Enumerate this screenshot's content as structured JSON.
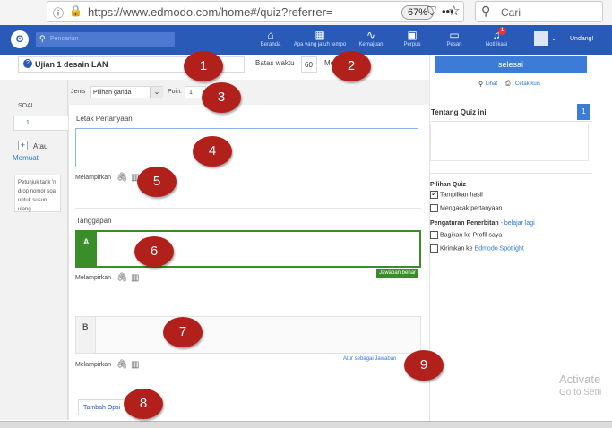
{
  "browser": {
    "url": "https://www.edmodo.com/home#/quiz?referrer=",
    "zoom": "67%",
    "search_placeholder": "Cari"
  },
  "nav": {
    "search_placeholder": "Pencarian",
    "items": [
      {
        "label": "Beranda",
        "icon": "home-icon"
      },
      {
        "label": "Apa yang jatuh tempo",
        "icon": "calendar-icon"
      },
      {
        "label": "Kemajuan",
        "icon": "progress-icon"
      },
      {
        "label": "Perpus",
        "icon": "library-icon"
      },
      {
        "label": "Pesan",
        "icon": "message-icon"
      },
      {
        "label": "Notifikasi",
        "icon": "bell-icon"
      }
    ],
    "notification_count": "1",
    "user_label": "Undang!"
  },
  "quiz": {
    "title": "Ujian 1 desain LAN",
    "time_limit_label": "Batas waktu",
    "time_limit_value": "60",
    "time_unit": "Me"
  },
  "sidebar": {
    "soal_label": "SOAL",
    "question_number": "1",
    "add_label": "Atau",
    "add_sub": "Memuat",
    "hint": "Petunjuk tarik 'n drop nomor soal untuk susun ulang"
  },
  "question": {
    "type_label": "Jenis",
    "type_value": "Pilihan ganda",
    "points_label": "Poin:",
    "points_value": "1",
    "section_title": "Letak Pertanyaan",
    "attach_label": "Melampirkan"
  },
  "responses": {
    "title": "Tanggapan",
    "option_a": "A",
    "option_b": "B",
    "correct_badge": "Jawaban benar",
    "set_correct": "Atur sebagai Jawaban",
    "attach_label": "Melampirkan",
    "add_option": "Tambah Opsi"
  },
  "right": {
    "done_button": "selesai",
    "preview": "Lihat",
    "print": "Cetak kuis",
    "about_title": "Tentang Quiz ini",
    "about_badge": "1",
    "options_title": "Pilihan Quiz",
    "opt_show_results": "Tampilkan hasil",
    "opt_shuffle": "Mengacak pertanyaan",
    "publish_title": "Pengaturan Penerbitan",
    "publish_link": "belajar lagi",
    "opt_share_profile": "Bagikan ke Profil saya",
    "opt_send_prefix": "Kirimkan ke",
    "opt_send_link": "Edmodo Spotlight"
  },
  "markers": [
    "1",
    "2",
    "3",
    "4",
    "5",
    "6",
    "7",
    "8",
    "9"
  ],
  "watermark": {
    "line1": "Activate",
    "line2": "Go to Setti"
  },
  "colors": {
    "nav_blue": "#2a5ab8",
    "button_blue": "#3c7bd6",
    "correct_green": "#3a8e2a",
    "marker_red": "#b1201b"
  }
}
